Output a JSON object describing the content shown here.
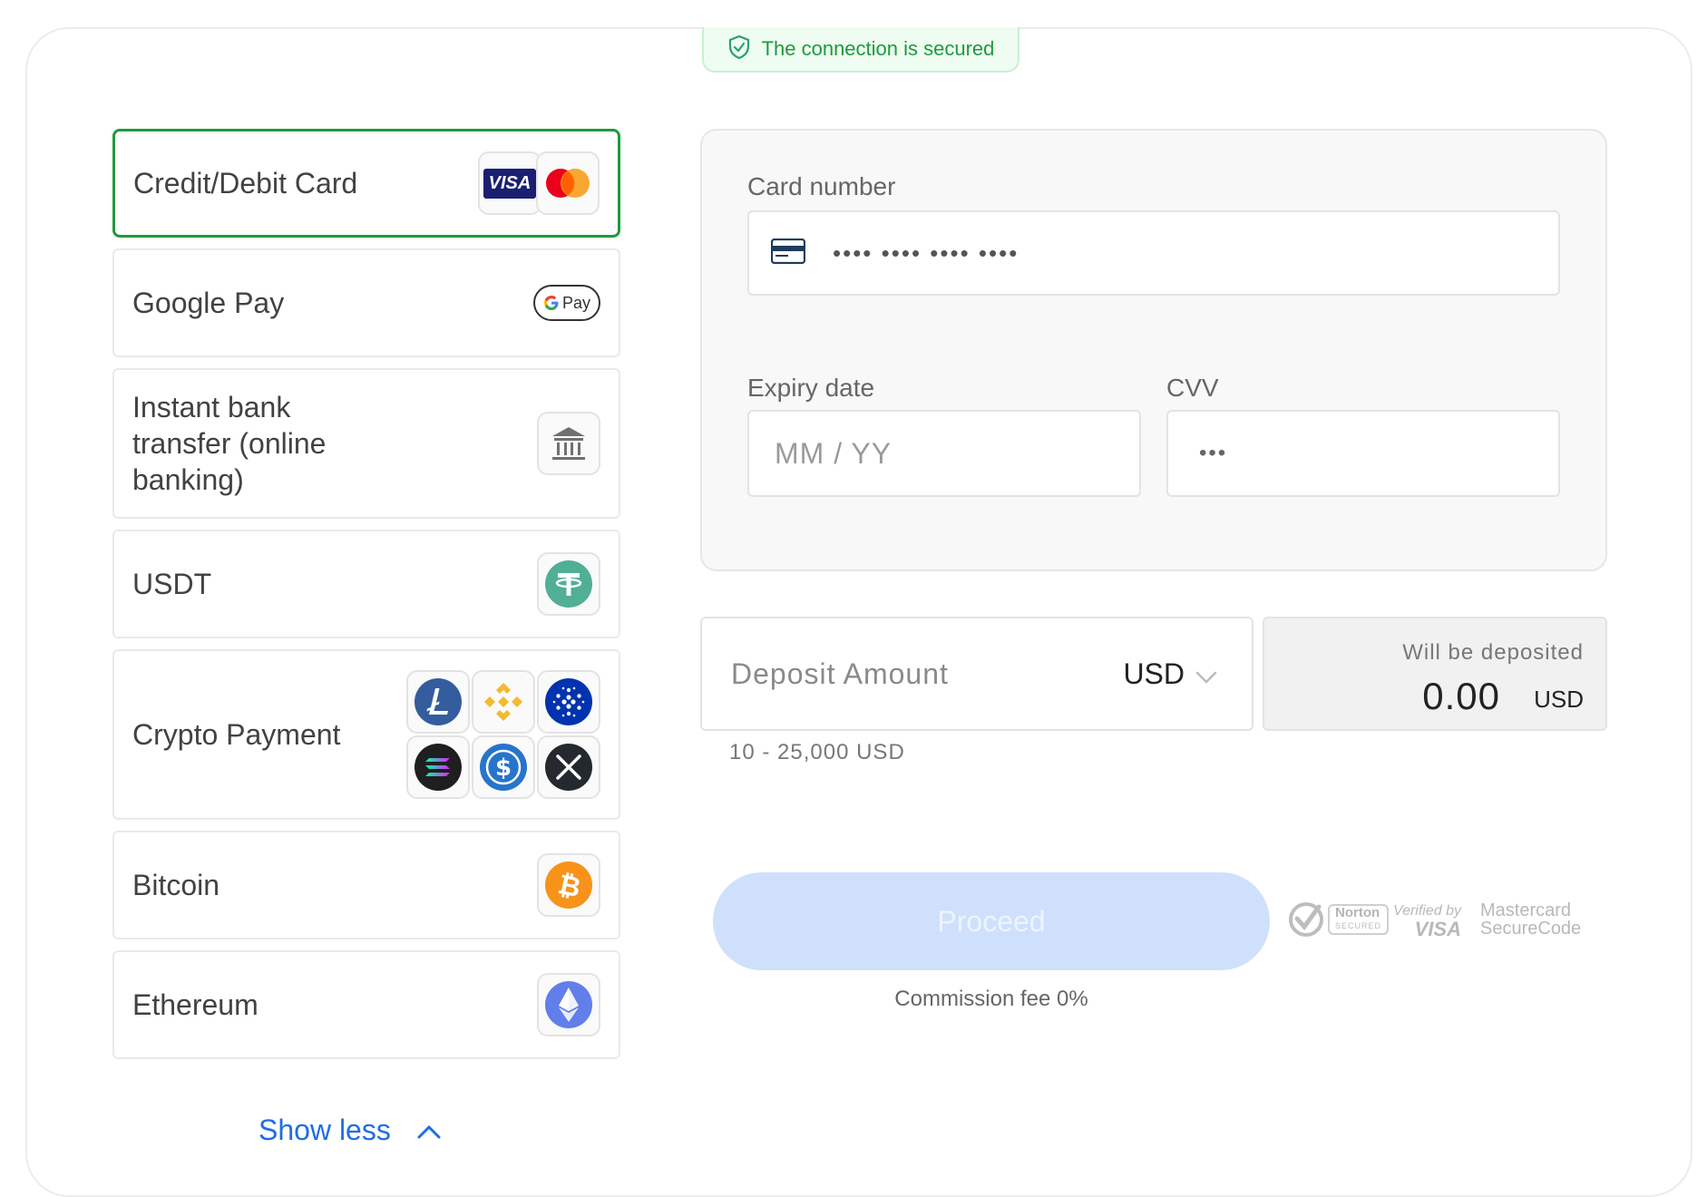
{
  "security": {
    "text": "The connection is secured"
  },
  "methods": [
    {
      "label": "Credit/Debit Card",
      "selected": true,
      "icons": [
        "visa-logo",
        "mastercard-logo"
      ]
    },
    {
      "label": "Google Pay",
      "icons": [
        "google-pay-logo"
      ]
    },
    {
      "label": "Instant bank transfer (online banking)",
      "icons": [
        "bank-icon"
      ]
    },
    {
      "label": "USDT",
      "icons": [
        "tether-icon"
      ]
    },
    {
      "label": "Crypto Payment",
      "icons": [
        "litecoin-icon",
        "binance-icon",
        "cardano-icon",
        "solana-icon",
        "usdc-icon",
        "xrp-icon"
      ]
    },
    {
      "label": "Bitcoin",
      "icons": [
        "bitcoin-icon"
      ]
    },
    {
      "label": "Ethereum",
      "icons": [
        "ethereum-icon"
      ]
    }
  ],
  "logos": {
    "visa": "VISA",
    "gpay": "Pay"
  },
  "show_less": "Show less",
  "card_form": {
    "card_number_label": "Card number",
    "card_number_placeholder": "•••• •••• •••• ••••",
    "expiry_label": "Expiry date",
    "expiry_placeholder": "MM / YY",
    "cvv_label": "CVV",
    "cvv_placeholder": "•••"
  },
  "deposit": {
    "label": "Deposit Amount",
    "currency": "USD",
    "range": "10 - 25,000 USD",
    "will_be_deposited_label": "Will be deposited",
    "will_be_deposited_amount": "0.00",
    "will_be_deposited_currency": "USD"
  },
  "proceed_label": "Proceed",
  "commission": "Commission fee 0%",
  "trust": {
    "norton_line1": "Norton",
    "norton_line2": "SECURED",
    "visa_line1": "Verified by",
    "visa_line2": "VISA",
    "mc_line1": "Mastercard",
    "mc_line2": "SecureCode"
  },
  "colors": {
    "accent_green": "#1f9a3c",
    "link_blue": "#1f6ee8",
    "proceed_disabled": "#cfe0fd"
  }
}
